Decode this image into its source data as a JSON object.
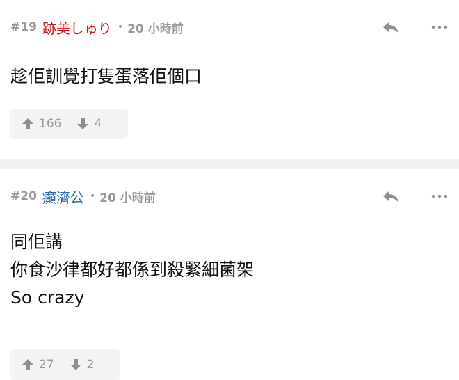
{
  "comments": [
    {
      "number": "#19",
      "author": "跡美しゅり",
      "separator": "•",
      "time": "20 小時前",
      "body": [
        "趁佢訓覺打隻蛋落佢個口"
      ],
      "upvotes": "166",
      "downvotes": "4",
      "author_color": "#c5141e"
    },
    {
      "number": "#20",
      "author": "癲濟公",
      "separator": "•",
      "time": "20 小時前",
      "body": [
        "同佢講",
        "你食沙律都好都係到殺緊細菌架",
        "So crazy"
      ],
      "upvotes": "27",
      "downvotes": "2",
      "author_color": "#2e6aa6"
    }
  ],
  "icons": {
    "reply": "reply-icon",
    "more": "more-icon",
    "upvote": "arrow-up-icon",
    "downvote": "arrow-down-icon"
  }
}
